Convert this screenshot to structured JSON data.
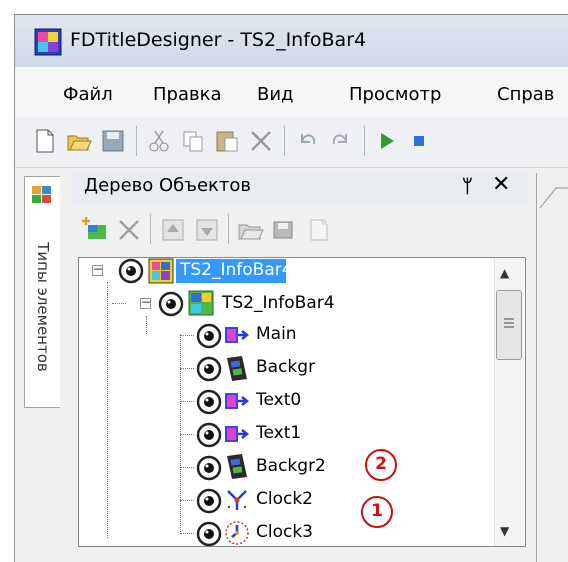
{
  "window": {
    "title": "FDTitleDesigner - TS2_InfoBar4"
  },
  "menu": [
    "Файл",
    "Правка",
    "Вид",
    "Просмотр",
    "Справ"
  ],
  "toolbar": {
    "icons": [
      "new-icon",
      "open-icon",
      "save-icon",
      "cut-icon",
      "copy-icon",
      "paste-icon",
      "delete-icon",
      "undo-icon",
      "redo-icon",
      "play-icon",
      "stop-icon"
    ]
  },
  "side_tab": {
    "label": "Типы элементов"
  },
  "panel": {
    "title": "Дерево Объектов",
    "pin": "ᛘ",
    "close": "✕",
    "toolbar_icons": [
      "add-object-icon",
      "delete-object-icon",
      "move-up-icon",
      "move-down-icon",
      "open-file-icon",
      "save-file-icon",
      "properties-icon"
    ]
  },
  "tree": {
    "root": {
      "label": "TS2_InfoBar4",
      "selected": true,
      "expanded": true
    },
    "group": {
      "label": "TS2_InfoBar4",
      "expanded": true
    },
    "items": [
      {
        "label": "Main",
        "icon": "text-object-icon"
      },
      {
        "label": "Backgr",
        "icon": "video-object-icon"
      },
      {
        "label": "Text0",
        "icon": "text-object-icon"
      },
      {
        "label": "Text1",
        "icon": "text-object-icon"
      },
      {
        "label": "Backgr2",
        "icon": "video-object-icon"
      },
      {
        "label": "Clock2",
        "icon": "clock-hands-icon"
      },
      {
        "label": "Clock3",
        "icon": "clock-face-icon"
      }
    ]
  },
  "annotations": [
    "2",
    "1"
  ],
  "colors": {
    "selection": "#3399ff",
    "badge": "#c21313"
  }
}
